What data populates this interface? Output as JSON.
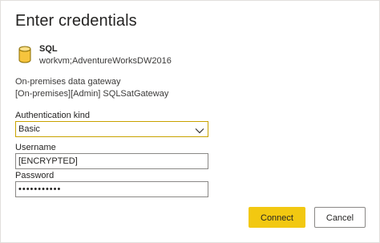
{
  "dialog": {
    "title": "Enter credentials"
  },
  "source": {
    "icon": "database-cylinder-icon",
    "name": "SQL",
    "path": "workvm;AdventureWorksDW2016"
  },
  "gateway": {
    "label": "On-premises data gateway",
    "name": "[On-premises][Admin] SQLSatGateway"
  },
  "auth": {
    "label": "Authentication kind",
    "selected": "Basic"
  },
  "username": {
    "label": "Username",
    "value": "[ENCRYPTED]"
  },
  "password": {
    "label": "Password",
    "value": "•••••••••••"
  },
  "buttons": {
    "connect": "Connect",
    "cancel": "Cancel"
  },
  "colors": {
    "accent": "#f2c811",
    "focus_border": "#c8a200",
    "icon_fill": "#f6c43d"
  }
}
